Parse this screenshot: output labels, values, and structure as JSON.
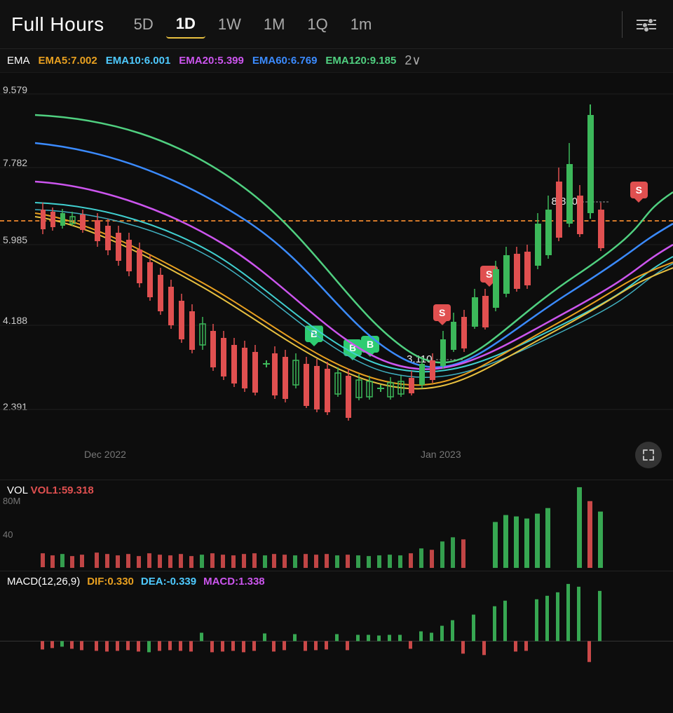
{
  "toolbar": {
    "title": "Full Hours",
    "timeframes": [
      "5D",
      "1D",
      "1W",
      "1M",
      "1Q",
      "1m"
    ],
    "active": "1D"
  },
  "ema": {
    "label": "EMA",
    "items": [
      {
        "key": "EMA5",
        "value": "7.002",
        "class": "ema5"
      },
      {
        "key": "EMA10",
        "value": "6.001",
        "class": "ema10"
      },
      {
        "key": "EMA20",
        "value": "5.399",
        "class": "ema20"
      },
      {
        "key": "EMA60",
        "value": "6.769",
        "class": "ema60"
      },
      {
        "key": "EMA120",
        "value": "9.185",
        "class": "ema120"
      }
    ],
    "more": "2"
  },
  "chart": {
    "price_labels": [
      "9.579",
      "7.782",
      "5.985",
      "4.188",
      "2.391"
    ],
    "annotations": {
      "high_price": "8.860",
      "low_price": "3.110"
    },
    "date_labels": [
      "Dec 2022",
      "Jan 2023"
    ],
    "signals": {
      "buy": [
        "B",
        "B",
        "B"
      ],
      "sell": [
        "S",
        "S",
        "S"
      ]
    }
  },
  "volume": {
    "label": "VOL",
    "value": "VOL1:59.318",
    "y_labels": [
      "80M",
      "40"
    ]
  },
  "macd": {
    "label": "MACD(12,26,9)",
    "dif_label": "DIF:",
    "dif_value": "0.330",
    "dea_label": "DEA:",
    "dea_value": "-0.339",
    "macd_label": "MACD:",
    "macd_value": "1.338"
  }
}
